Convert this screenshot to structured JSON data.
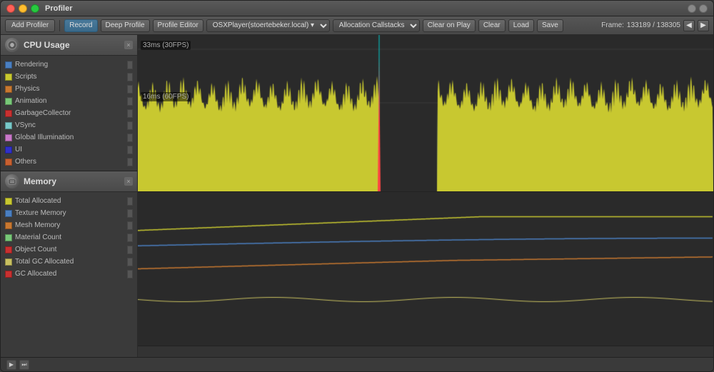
{
  "window": {
    "title": "Profiler"
  },
  "title_bar": {
    "close_label": "",
    "min_label": "",
    "max_label": "",
    "right_btn1": "",
    "right_btn2": "",
    "right_btn3": ""
  },
  "toolbar": {
    "add_profiler_label": "Add Profiler",
    "record_label": "Record",
    "deep_profile_label": "Deep Profile",
    "profile_editor_label": "Profile Editor",
    "target_label": "OSXPlayer(stoertebeker.local) ▾",
    "allocation_label": "Allocation Callstacks",
    "clear_on_play_label": "Clear on Play",
    "clear_label": "Clear",
    "load_label": "Load",
    "save_label": "Save",
    "frame_label": "Frame:",
    "frame_value": "133189 / 138305",
    "prev_label": "◀",
    "next_label": "▶"
  },
  "cpu_section": {
    "title": "CPU Usage",
    "close_label": "×",
    "label_30fps": "33ms (30FPS)",
    "label_60fps": "16ms (60FPS)",
    "legend": [
      {
        "id": "rendering",
        "label": "Rendering",
        "color": "#4a7fc1"
      },
      {
        "id": "scripts",
        "label": "Scripts",
        "color": "#c8c830"
      },
      {
        "id": "physics",
        "label": "Physics",
        "color": "#c87830"
      },
      {
        "id": "animation",
        "label": "Animation",
        "color": "#78c878"
      },
      {
        "id": "gc",
        "label": "GarbageCollector",
        "color": "#c83030"
      },
      {
        "id": "vsync",
        "label": "VSync",
        "color": "#78c8c8"
      },
      {
        "id": "global_illumination",
        "label": "Global Illumination",
        "color": "#c878c8"
      },
      {
        "id": "ui",
        "label": "UI",
        "color": "#3030c8"
      },
      {
        "id": "others",
        "label": "Others",
        "color": "#c86030"
      }
    ]
  },
  "memory_section": {
    "title": "Memory",
    "close_label": "×",
    "legend": [
      {
        "id": "total_allocated",
        "label": "Total Allocated",
        "color": "#c8c830"
      },
      {
        "id": "texture_memory",
        "label": "Texture Memory",
        "color": "#4a7fc1"
      },
      {
        "id": "mesh_memory",
        "label": "Mesh Memory",
        "color": "#c87830"
      },
      {
        "id": "material_count",
        "label": "Material Count",
        "color": "#78c878"
      },
      {
        "id": "object_count",
        "label": "Object Count",
        "color": "#c83030"
      },
      {
        "id": "total_gc",
        "label": "Total GC Allocated",
        "color": "#c8c060"
      },
      {
        "id": "gc_allocated",
        "label": "GC Allocated",
        "color": "#c83030"
      }
    ]
  }
}
